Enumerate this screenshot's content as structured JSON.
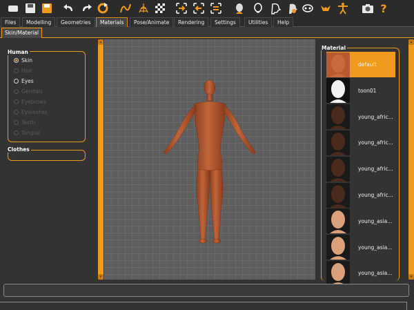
{
  "toolbar": {
    "icons": [
      "open-file-icon",
      "save-icon",
      "export-icon",
      "undo-icon",
      "redo-icon",
      "reset-icon",
      "smooth-icon",
      "wireframe-icon",
      "checker-background-icon",
      "front-view-icon",
      "back-view-icon",
      "side-view-icon",
      "head-front-icon",
      "head-back-icon",
      "head-side-icon",
      "head-top-icon",
      "face-view-icon",
      "full-body-icon",
      "pose-icon",
      "screenshot-icon",
      "help-icon"
    ],
    "help_glyph": "?"
  },
  "menu": {
    "tabs": [
      "Files",
      "Modelling",
      "Geometries",
      "Materials",
      "Pose/Animate",
      "Rendering",
      "Settings",
      "Utilities",
      "Help"
    ],
    "active": "Materials"
  },
  "subtabs": {
    "active_label": "Skin/Material"
  },
  "left_panel": {
    "human_title": "Human",
    "human_items": [
      {
        "label": "Skin",
        "selected": true,
        "enabled": true
      },
      {
        "label": "Hair",
        "selected": false,
        "enabled": false
      },
      {
        "label": "Eyes",
        "selected": false,
        "enabled": true
      },
      {
        "label": "Genitals",
        "selected": false,
        "enabled": false
      },
      {
        "label": "Eyebrows",
        "selected": false,
        "enabled": false
      },
      {
        "label": "Eyelashes",
        "selected": false,
        "enabled": false
      },
      {
        "label": "Teeth",
        "selected": false,
        "enabled": false
      },
      {
        "label": "Tongue",
        "selected": false,
        "enabled": false
      }
    ],
    "clothes_title": "Clothes"
  },
  "right_panel": {
    "title": "Material",
    "materials": [
      {
        "label": "default",
        "selected": true,
        "skin": "#b85a30",
        "face": "#c86a3c"
      },
      {
        "label": "toon01",
        "selected": false,
        "skin": "#111111",
        "face": "#f2f2f2"
      },
      {
        "label": "young_afric...",
        "selected": false,
        "skin": "#2a1a12",
        "face": "#4a2a1c"
      },
      {
        "label": "young_afric...",
        "selected": false,
        "skin": "#2a1a12",
        "face": "#4a2a1c"
      },
      {
        "label": "young_afric...",
        "selected": false,
        "skin": "#2a1a12",
        "face": "#4a2a1c"
      },
      {
        "label": "young_afric...",
        "selected": false,
        "skin": "#2a1a12",
        "face": "#4a2a1c"
      },
      {
        "label": "young_asia...",
        "selected": false,
        "skin": "#f0f0f0",
        "face": "#d9a07a"
      },
      {
        "label": "young_asia...",
        "selected": false,
        "skin": "#f0f0f0",
        "face": "#d9a07a"
      },
      {
        "label": "young_asia...",
        "selected": false,
        "skin": "#f0f0f0",
        "face": "#d9a07a"
      }
    ]
  },
  "colors": {
    "accent": "#f09a1e",
    "model_skin": "#b0532c",
    "viewport_bg": "#5e5e5e"
  }
}
